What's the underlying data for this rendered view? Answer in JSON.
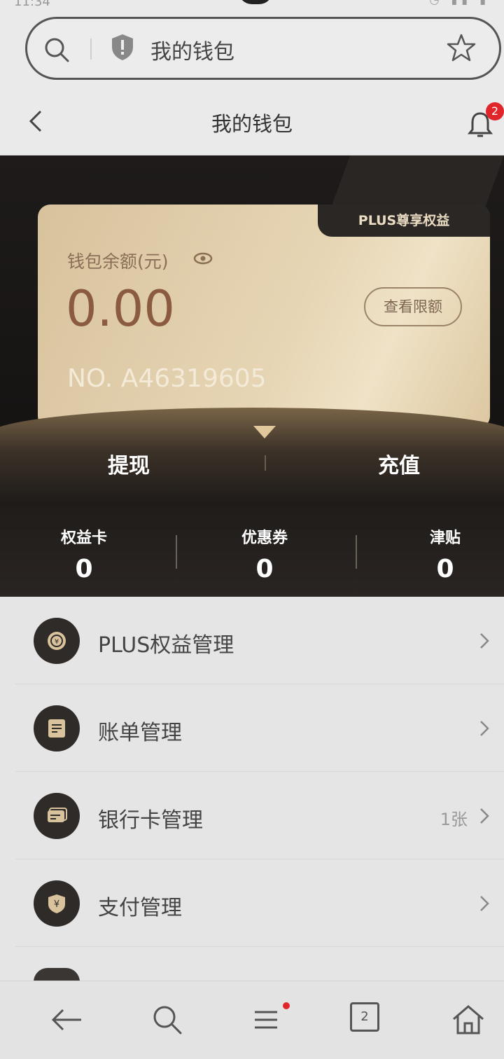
{
  "status_bar": {
    "time": "11:34"
  },
  "browser": {
    "address_text": "我的钱包"
  },
  "header": {
    "title": "我的钱包",
    "notification_badge": "2"
  },
  "wallet_card": {
    "tag": "PLUS尊享权益",
    "balance_label": "钱包余额(元)",
    "balance": "0.00",
    "limit_button": "查看限额",
    "wallet_no": "NO. A46319605"
  },
  "actions": {
    "withdraw": "提现",
    "recharge": "充值"
  },
  "stats": [
    {
      "label": "权益卡",
      "value": "0"
    },
    {
      "label": "优惠券",
      "value": "0"
    },
    {
      "label": "津贴",
      "value": "0"
    }
  ],
  "menu": [
    {
      "label": "PLUS权益管理",
      "extra": "",
      "icon": "coin-icon"
    },
    {
      "label": "账单管理",
      "extra": "",
      "icon": "bill-icon"
    },
    {
      "label": "银行卡管理",
      "extra": "1张",
      "icon": "bank-card-icon"
    },
    {
      "label": "支付管理",
      "extra": "",
      "icon": "yen-shield-icon"
    }
  ],
  "bottom_nav": {
    "tab_count": "2",
    "items": [
      "back-arrow-icon",
      "search-icon",
      "menu-icon",
      "tabs-icon",
      "home-icon"
    ]
  },
  "colors": {
    "accent_gold": "#d8c29d",
    "dark": "#1e1b1a",
    "badge_red": "#e0262b"
  }
}
